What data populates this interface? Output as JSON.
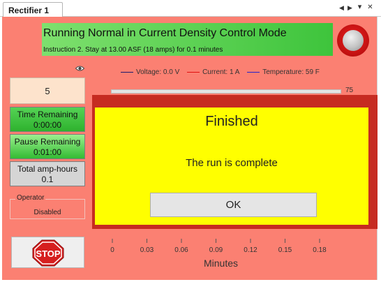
{
  "window": {
    "tab_label": "Rectifier 1",
    "controls": {
      "prev": "◀",
      "next": "▶",
      "menu": "▾",
      "close": "✕"
    }
  },
  "status": {
    "title": "Running Normal in Current Density Control Mode",
    "instruction": "Instruction 2. Stay at 13.00 ASF (18 amps) for 0.1 minutes",
    "banner_color": "#3ec43c",
    "indicator_color": "#c01010"
  },
  "left_panel": {
    "value": "5",
    "time_remaining": {
      "label": "Time Remaining",
      "value": "0:00:00"
    },
    "pause_remaining": {
      "label": "Pause Remaining",
      "value": "0:01:00"
    },
    "total_amp_hours": {
      "label": "Total amp-hours",
      "value": "0.1"
    },
    "operator": {
      "label": "Operator",
      "value": "Disabled"
    },
    "stop_label": "STOP"
  },
  "chart_data": {
    "type": "line",
    "legend": [
      {
        "name": "Voltage: 0.0 V",
        "color": "#1a1a6e"
      },
      {
        "name": "Current: 1 A",
        "color": "#e01010"
      },
      {
        "name": "Temperature: 59 F",
        "color": "#2222cc"
      }
    ],
    "x_ticks": [
      "0",
      "0.03",
      "0.06",
      "0.09",
      "0.12",
      "0.15",
      "0.18"
    ],
    "x_tick_values": [
      0,
      0.03,
      0.06,
      0.09,
      0.12,
      0.15,
      0.18
    ],
    "xlim": [
      0,
      0.2
    ],
    "y_top_tick": "75",
    "xlabel": "Minutes"
  },
  "dialog": {
    "title": "Finished",
    "message": "The run is complete",
    "ok_label": "OK"
  },
  "colors": {
    "panel_background": "#fb8072",
    "dialog_background": "#ffff00",
    "dialog_frame": "#c62b21"
  }
}
